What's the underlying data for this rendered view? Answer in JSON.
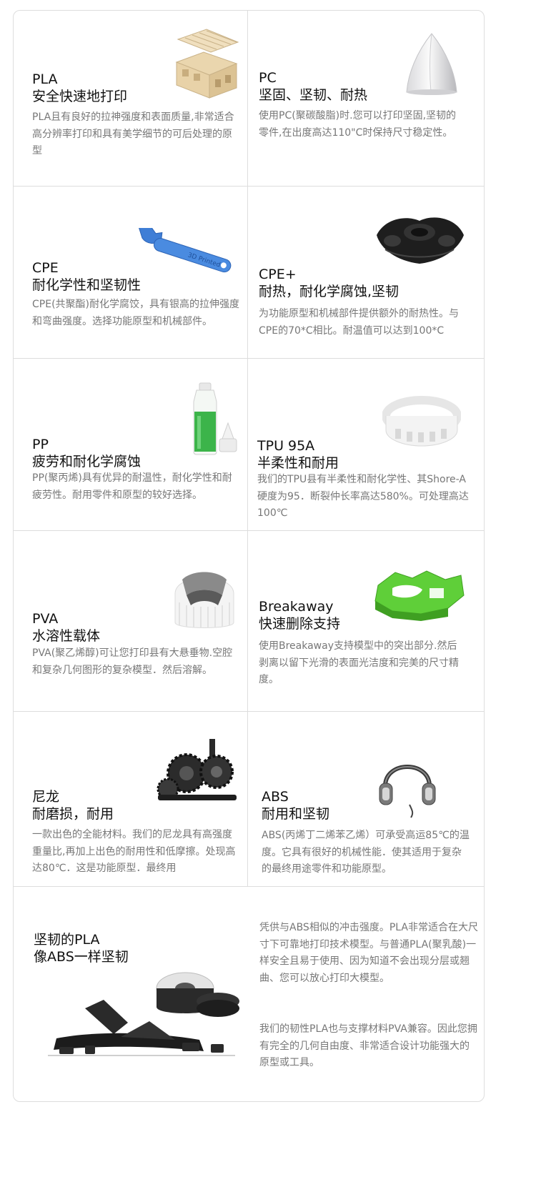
{
  "materials": [
    {
      "name": "PLA",
      "subtitle": "安全快速地打印",
      "description": "PLA且有良好的拉神强度和表面质量,非常适合高分辨率打印和具有美学细节的可后处理的原型"
    },
    {
      "name": "PC",
      "subtitle": "坚固、坚韧、耐热",
      "description": "使用PC(聚碳酸脂)时.您可以打印坚固,坚韧的零件,在出度高达110\"C时保持尺寸稳定性。"
    },
    {
      "name": "CPE",
      "subtitle": "耐化学性和坚韧性",
      "description": "CPE(共聚酯)耐化学腐饺，具有银高的拉伸强度和弯曲强度。选择功能原型和机械部件。"
    },
    {
      "name": "CPE+",
      "subtitle": "耐热，耐化学腐蚀,坚韧",
      "description": "为功能原型和机械部件提供额外的耐热性。与CPE的70*C相比。耐温值可以达到100*C"
    },
    {
      "name": "PP",
      "subtitle": "疲劳和耐化学腐蚀",
      "description": "PP(聚丙烯)具有优异的耐温性，耐化学性和耐疲劳性。耐用零件和原型的较好选择。"
    },
    {
      "name": "TPU 95A",
      "subtitle": "半柔性和耐用",
      "description": "我们的TPU县有半柔性和耐化学性、其Shore-A硬度为95．断裂仲长率高达580%。可处理高达100℃"
    },
    {
      "name": "PVA",
      "subtitle": "水溶性载体",
      "description": "PVA(聚乙烯醇)可让您打印县有大悬垂物.空腔和复杂几何图形的复杂模型．然后溶解。"
    },
    {
      "name": "Breakaway",
      "subtitle": "快速删除支持",
      "description": "使用Breakaway支持模型中的突出部分.然后剥离以留下光滑的表面光洁度和完美的尺寸精度。"
    },
    {
      "name": "尼龙",
      "subtitle": "耐磨损，耐用",
      "description": "一款出色的全能材料。我们的尼龙具有高强度重量比,再加上出色的耐用性和低摩擦。处现高达80℃．这是功能原型．最终用"
    },
    {
      "name": "ABS",
      "subtitle": "耐用和坚韧",
      "description": "ABS(丙烯丁二烯苯乙烯）可承受高运85℃的温度。它具有很好的机械性能．使其适用于复杂的最终用途零件和功能原型。"
    }
  ],
  "tough_pla": {
    "title_line1": "坚韧的PLA",
    "title_line2": "像ABS一样坚韧",
    "paragraph1": "凭供与ABS相似的冲击强度。PLA非常适合在大尺寸下可靠地打印技术模型。与普通PLA(聚乳酸)一样安全且易于使用、因为知道不会出现分层或翘曲、您可以放心打印大模型。",
    "paragraph2": "我们的韧性PLA也与支撑材料PVA兼容。因此您拥有完全的几何自由度、非常适合设计功能强大的原型或工具。"
  },
  "images": {
    "wrench_text": "3D Printed"
  }
}
